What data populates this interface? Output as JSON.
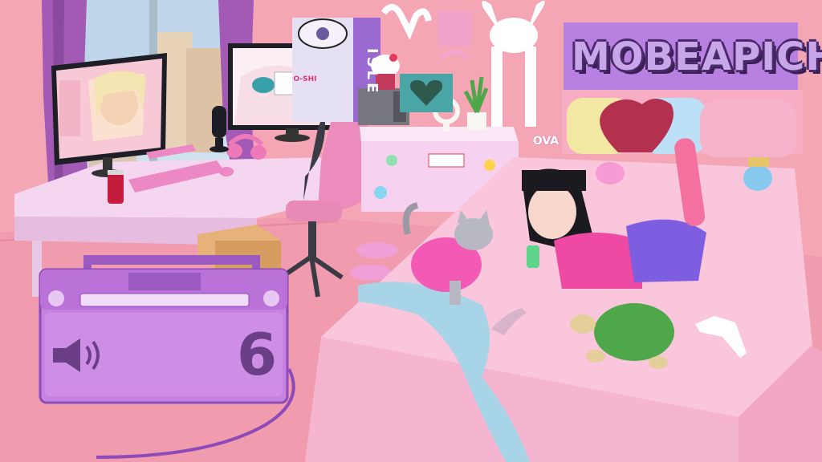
{
  "scene": {
    "banner": {
      "text": "MOBEAPICH"
    },
    "poster": {
      "text": "ISLE"
    },
    "sticker": {
      "text": "OVA"
    },
    "monitor_right": {
      "screen_text": "O-SHI"
    },
    "boombox": {
      "volume_label": "6",
      "volume_icon": "speaker-icon"
    }
  },
  "colors": {
    "wall": "#f4a6b4",
    "floor": "#f0a0b0",
    "bed": "#f9c6dc",
    "desk": "#f3d4ee",
    "boombox": "#c682e0",
    "banner": "#b880e0",
    "accent_dark": "#4a2a6a"
  }
}
